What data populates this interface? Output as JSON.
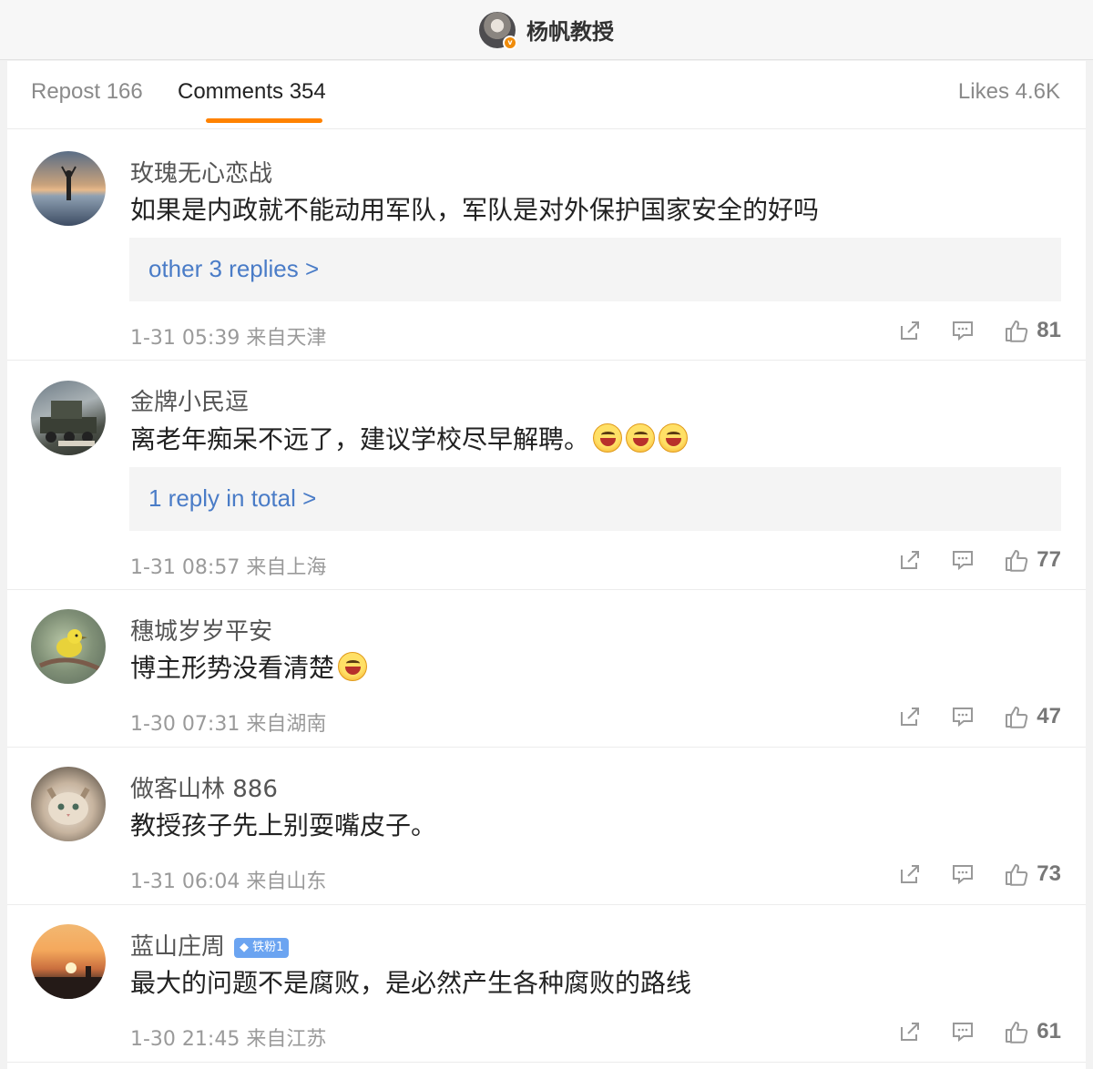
{
  "header": {
    "username": "杨帆教授",
    "avatar_icon": "user-avatar-photo",
    "verified_badge": "v"
  },
  "tabs": {
    "repost": "Repost 166",
    "comments": "Comments 354",
    "likes": "Likes 4.6K",
    "active": "comments",
    "accent_color": "#ff8200"
  },
  "comments": [
    {
      "user": "玫瑰无心恋战",
      "text": "如果是内政就不能动用军队，军队是对外保护国家安全的好吗",
      "replies": "other 3 replies >",
      "meta": "1-31 05:39 来自天津",
      "likes": "81"
    },
    {
      "user": "金牌小民逗",
      "text": "离老年痴呆不远了，建议学校尽早解聘。",
      "emojis": [
        "laughing-emoji",
        "laughing-emoji",
        "laughing-emoji"
      ],
      "replies": "1 reply in total >",
      "meta": "1-31 08:57 来自上海",
      "likes": "77"
    },
    {
      "user": "穗城岁岁平安",
      "text": "博主形势没看清楚",
      "emojis": [
        "crying-laughing-emoji"
      ],
      "meta": "1-30 07:31 来自湖南",
      "likes": "47"
    },
    {
      "user": "做客山林 886",
      "text": "教授孩子先上别耍嘴皮子。",
      "meta": "1-31 06:04 来自山东",
      "likes": "73"
    },
    {
      "user": "蓝山庄周",
      "badge": "铁粉1",
      "text": "最大的问题不是腐败，是必然产生各种腐败的路线",
      "meta": "1-30 21:45 来自江苏",
      "likes": "61"
    }
  ],
  "icons": {
    "share": "share-icon",
    "comment": "comment-icon",
    "like": "thumbs-up-icon"
  },
  "colors": {
    "link": "#4a7cc7",
    "badge": "#6ba4f1"
  }
}
